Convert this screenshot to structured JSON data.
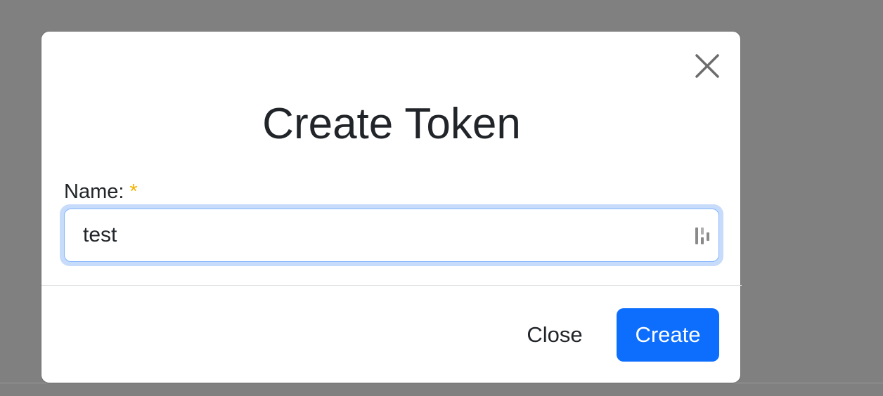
{
  "modal": {
    "title": "Create Token",
    "close_icon": "close-icon"
  },
  "form": {
    "name_label": "Name:",
    "required_marker": "*",
    "name_value": "test",
    "input_tool_icon": "password-manager-icon"
  },
  "footer": {
    "close_label": "Close",
    "create_label": "Create"
  },
  "colors": {
    "backdrop": "#808080",
    "primary": "#0d6efd",
    "required": "#f4b400",
    "focus_ring": "#c7dbfb"
  }
}
